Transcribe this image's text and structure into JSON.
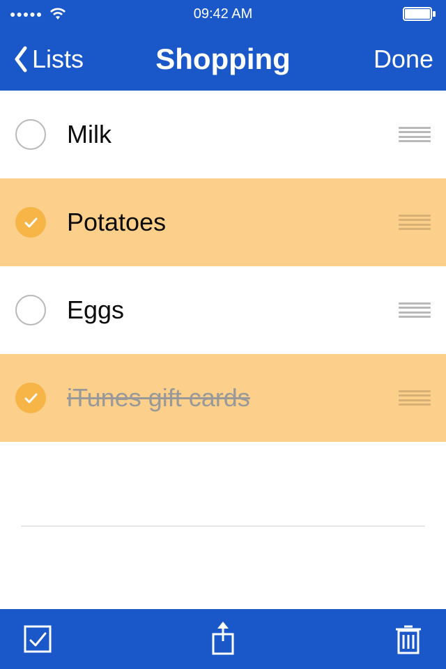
{
  "status_bar": {
    "time": "09:42 AM"
  },
  "nav": {
    "back_label": "Lists",
    "title": "Shopping",
    "done_label": "Done"
  },
  "items": [
    {
      "label": "Milk",
      "checked": false,
      "struck": false
    },
    {
      "label": "Potatoes",
      "checked": true,
      "struck": false
    },
    {
      "label": "Eggs",
      "checked": false,
      "struck": false
    },
    {
      "label": "iTunes gift cards",
      "checked": true,
      "struck": true
    }
  ],
  "colors": {
    "brand": "#1a58c9",
    "highlight": "#fcd08a",
    "check_fill": "#f7b548"
  }
}
